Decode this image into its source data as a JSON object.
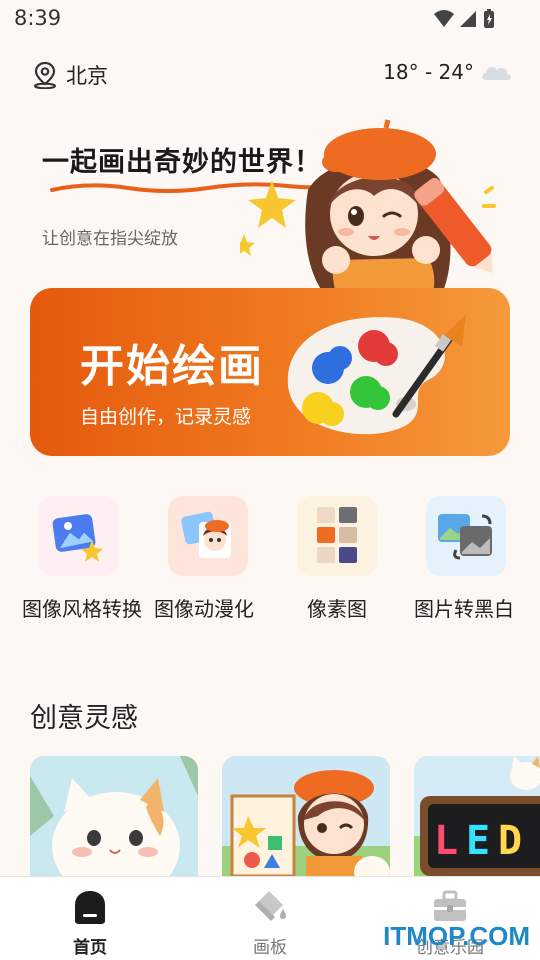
{
  "status": {
    "time": "8:39"
  },
  "topbar": {
    "location": "北京",
    "weather": "18° - 24°"
  },
  "hero": {
    "title": "一起画出奇妙的世界！",
    "subtitle": "让创意在指尖绽放"
  },
  "start_card": {
    "title": "开始绘画",
    "subtitle": "自由创作，记录灵感"
  },
  "tools": [
    {
      "label": "图像风格转换"
    },
    {
      "label": "图像动漫化"
    },
    {
      "label": "像素图"
    },
    {
      "label": "图片转黑白"
    }
  ],
  "section": {
    "title": "创意灵感"
  },
  "tabs": [
    {
      "label": "首页"
    },
    {
      "label": "画板"
    },
    {
      "label": "创意乐园"
    }
  ],
  "watermark": "ITMOP.COM",
  "colors": {
    "accent": "#ee6a16",
    "background": "#fdf8f3"
  }
}
